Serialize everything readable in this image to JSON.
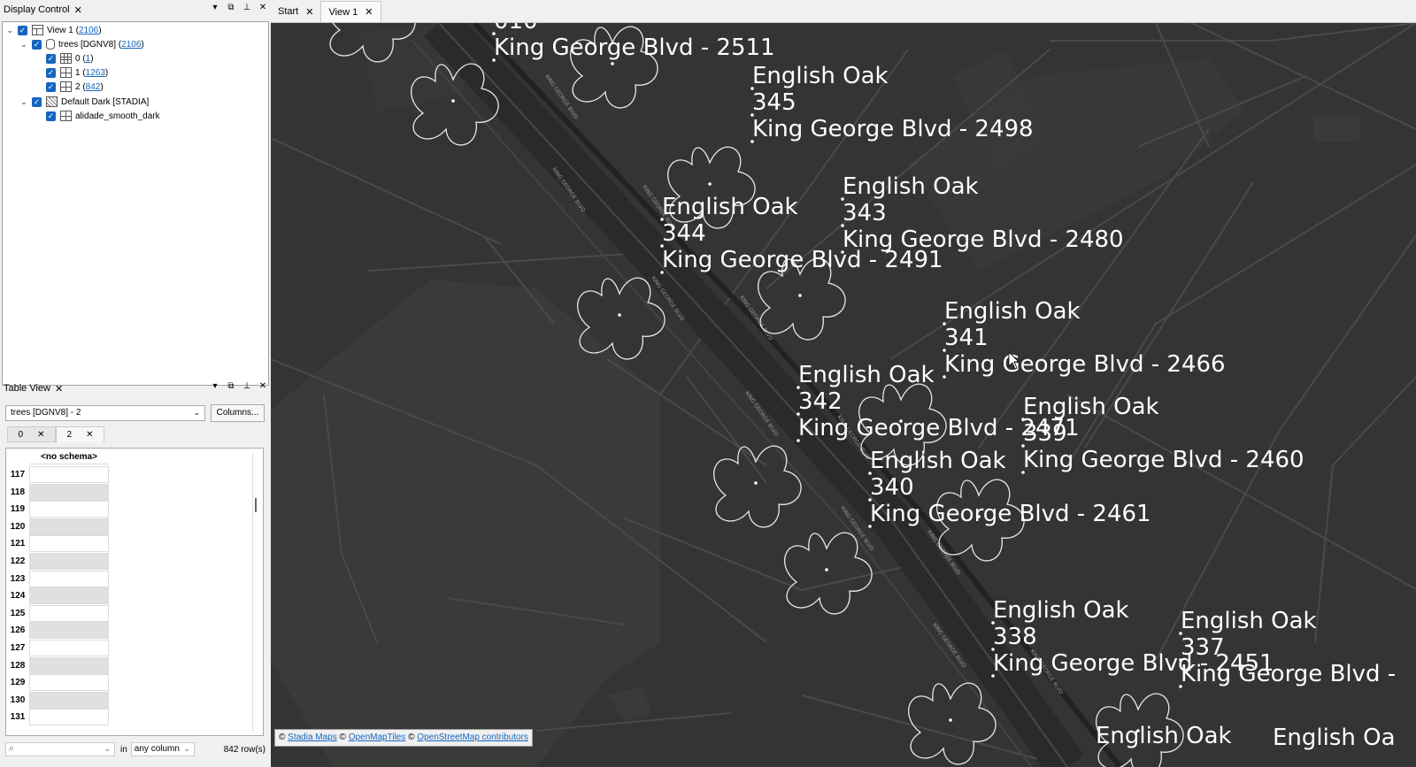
{
  "display_control": {
    "title": "Display Control",
    "tree": [
      {
        "label": "View 1 (",
        "count": "2106",
        "suffix": ")"
      },
      {
        "label": "trees [DGNV8] (",
        "count": "2106",
        "suffix": ")"
      },
      {
        "label": "0 (",
        "count": "1",
        "suffix": ")"
      },
      {
        "label": "1 (",
        "count": "1263",
        "suffix": ")"
      },
      {
        "label": "2 (",
        "count": "842",
        "suffix": ")"
      },
      {
        "label": "Default Dark [STADIA]",
        "count": "",
        "suffix": ""
      },
      {
        "label": "alidade_smooth_dark",
        "count": "",
        "suffix": ""
      }
    ]
  },
  "table_view": {
    "title": "Table View",
    "source": "trees [DGNV8] - 2",
    "columns_button": "Columns...",
    "tabs": [
      "0",
      "2"
    ],
    "header": "<no schema>",
    "rows": [
      "117",
      "118",
      "119",
      "120",
      "121",
      "122",
      "123",
      "124",
      "125",
      "126",
      "127",
      "128",
      "129",
      "130",
      "131"
    ],
    "in_label": "in",
    "column_filter": "any column",
    "row_count": "842 row(s)"
  },
  "doc_tabs": [
    "Start",
    "View 1"
  ],
  "map": {
    "labels": [
      {
        "name": "English Oak",
        "id": "345",
        "address": "King George Blvd - 2498"
      },
      {
        "name": "English Oak",
        "id": "343",
        "address": "King George Blvd - 2480"
      },
      {
        "name": "English Oak",
        "id": "344",
        "address": "King George Blvd - 2491"
      },
      {
        "name": "English Oak",
        "id": "341",
        "address": "King George Blvd - 2466"
      },
      {
        "name": "English Oak",
        "id": "342",
        "address": "King George Blvd - 2471"
      },
      {
        "name": "English Oak",
        "id": "339",
        "address": "King George Blvd - 2460"
      },
      {
        "name": "English Oak",
        "id": "340",
        "address": "King George Blvd - 2461"
      },
      {
        "name": "English Oak",
        "id": "338",
        "address": "King George Blvd - 2451"
      },
      {
        "name": "English Oak",
        "id": "337",
        "address": "King George Blvd -"
      }
    ],
    "top_partial": {
      "id": "010",
      "address": "King George Blvd - 2511"
    },
    "bottom_partial": [
      "English Oak",
      "English Oa"
    ],
    "street_name": "KING GEORGE BLVD",
    "attribution": {
      "copy": "©",
      "stadia": "Stadia Maps",
      "omt": "OpenMapTiles",
      "osm": "OpenStreetMap contributors"
    }
  }
}
